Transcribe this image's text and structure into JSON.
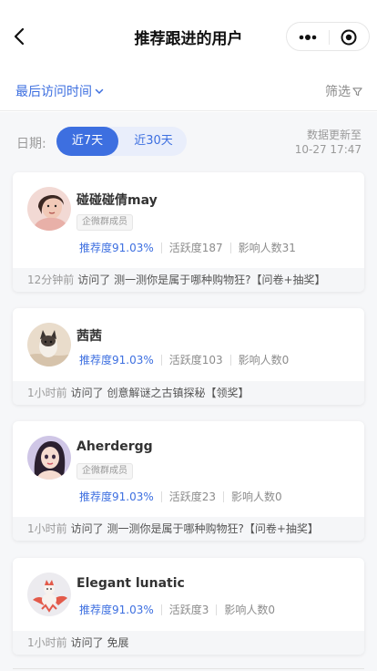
{
  "header": {
    "title": "推荐跟进的用户"
  },
  "filter_bar": {
    "sort_label": "最后访问时间",
    "filter_label": "筛选"
  },
  "date_filter": {
    "label": "日期:",
    "options": [
      "近7天",
      "近30天"
    ],
    "selected": "近7天",
    "update_line1": "数据更新至",
    "update_line2": "10-27 17:47"
  },
  "users": [
    {
      "name": "碰碰碰倩may",
      "tag": "企微群成员",
      "recommend": "推荐度91.03%",
      "activity": "活跃度187",
      "influence": "影响人数31",
      "visit_time": "12分钟前",
      "visit_text": "访问了 测一测你是属于哪种购物狂?【问卷+抽奖】"
    },
    {
      "name": "茜茜",
      "tag": "",
      "recommend": "推荐度91.03%",
      "activity": "活跃度103",
      "influence": "影响人数0",
      "visit_time": "1小时前",
      "visit_text": "访问了 创意解谜之古镇探秘【领奖】"
    },
    {
      "name": "Aherdergg",
      "tag": "企微群成员",
      "recommend": "推荐度91.03%",
      "activity": "活跃度23",
      "influence": "影响人数0",
      "visit_time": "1小时前",
      "visit_text": "访问了 测一测你是属于哪种购物狂?【问卷+抽奖】"
    },
    {
      "name": "Elegant lunatic",
      "tag": "",
      "recommend": "推荐度91.03%",
      "activity": "活跃度3",
      "influence": "影响人数0",
      "visit_time": "1小时前",
      "visit_text": "访问了 免展"
    }
  ],
  "colors": {
    "accent": "#3d6fe0",
    "muted": "#9a9a9a"
  },
  "icons": {
    "back": "chevron-left-icon",
    "more": "more-dots-icon",
    "close": "target-circle-icon",
    "sort_arrow": "chevron-down-icon",
    "filter": "funnel-icon"
  }
}
